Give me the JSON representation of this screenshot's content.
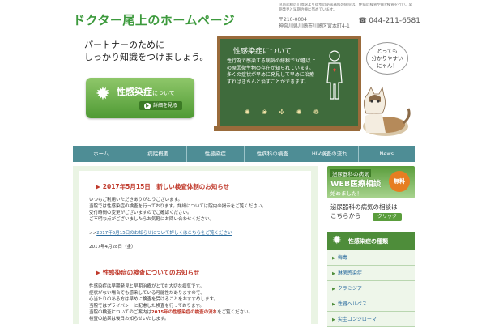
{
  "header": {
    "title": "ドクター尾上のホームページ",
    "note": "JR南武線の川崎駅より徒歩の泌尿器科の病院は、性病の検査やHIV検査を行い、早期発見と早期治療に努めています。",
    "zip": "〒210-0004",
    "address": "神奈川県川崎市川崎区宮本町4-1",
    "tel": "044-211-6581",
    "tel_icon": "☎"
  },
  "hero": {
    "catch_line1": "パートナーのために",
    "catch_line2": "しっかり知識をつけましょう。",
    "promo_title": "性感染症",
    "promo_suffix": "について",
    "promo_button": "詳細を見る",
    "board_title": "性感染症について",
    "board_text": "性行為で感染する病気の総称で30種以上の原因微生物の存在が知られています。多くの症状が早めに発見して早めに治療すればきちんと治すことができます。",
    "board_germs": "✺ ❀ ✣ ✺ ❁",
    "bubble_line1": "とっても",
    "bubble_line2": "分かりやすい",
    "bubble_line3": "にゃん！"
  },
  "nav": {
    "items": [
      "ホーム",
      "病院概要",
      "性感染症",
      "性病科の検査",
      "HIV検査の流れ",
      "News"
    ]
  },
  "posts": [
    {
      "title": "2017年5月15日　新しい検査体制のお知らせ",
      "lines": [
        "いつもご利用いただきありがとうございます。",
        "当院では性感染症の検査を行っております。詳細については院内の掲示をご覧ください。",
        "受付時間の変更がございますのでご確認ください。",
        "ご不明な点がございましたらお気軽にお問い合わせください。"
      ],
      "link_prefix": ">>",
      "link_text": "2017年5月15日のお知らせについて詳しくはこちらをご覧ください",
      "date": "2017年4月28日（金）"
    },
    {
      "title": "性感染症の検査についてのお知らせ",
      "lines": [
        "性感染症は早期発見と早期治療がとても大切な病気です。",
        "症状がない場合でも感染している可能性がありますので、",
        "心当たりのある方は早めに検査を受けることをおすすめします。",
        "当院ではプライバシーに配慮した検査を行っております。"
      ],
      "red_prefix": "当院の検査についてのご案内は",
      "red_text": "2015年の性感染症の検査の流れ",
      "red_suffix": "をご覧ください。",
      "last_line": "検査の結果は後日お知らせいたします。"
    }
  ],
  "sidebar": {
    "banner1_a": "泌尿器科の病気",
    "banner1_b": "WEB医療相談",
    "banner1_c": "始めました！",
    "banner1_badge": "無料",
    "banner2_line1": "泌尿器科の病気の相談は",
    "banner2_line2": "こちらから",
    "banner2_button": "クリック",
    "section_title": "性感染症の種類",
    "items": [
      "梅毒",
      "淋菌感染症",
      "クラミジア",
      "性器ヘルペス",
      "尖圭コンジローマ"
    ]
  }
}
